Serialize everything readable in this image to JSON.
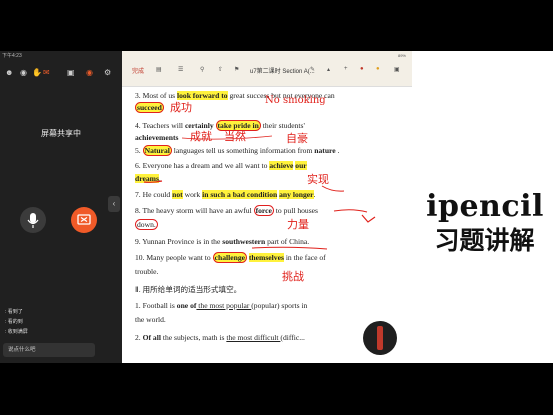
{
  "left_panel": {
    "status_time": "下午4:23",
    "share_title": "屏幕共享中",
    "share_subtitle": "",
    "mic_label": "",
    "stop_label": "",
    "chat": [
      {
        "name": "",
        "text": "看到了"
      },
      {
        "name": "",
        "text": "看的到"
      },
      {
        "name": "",
        "text": "收到满屏"
      }
    ],
    "chat_placeholder": "说点什么吧"
  },
  "toolbar": {
    "done_label": "完成",
    "doc_title": "u7第二课时  Section A(...",
    "status_text": "89%"
  },
  "doc": {
    "l3a_pre": "3.  Most of us ",
    "l3a_hl": "look forward to",
    "l3a_post": " great success but not everyone can",
    "l3b_hl": "succeed",
    "l4a_pre": "4.  Teachers  will  ",
    "l4a_b": "certainly",
    "l4a_sp": "  ",
    "l4a_hl": "take  pride  in",
    "l4a_post": "  their  students'",
    "l4b_b": "achievements",
    "l5_pre": "5.  ",
    "l5_hl": "Natural",
    "l5_mid": " languages tell us something information from ",
    "l5_b": "nature",
    "l5_post": " .",
    "l6a_pre": "6.  Everyone  has  a  dream  and  we  all  want  to  ",
    "l6a_hl1": "achieve",
    "l6a_sp": "  ",
    "l6a_hl2": "our",
    "l6b_hl": "dreams",
    "l6b_post": ".",
    "l7_pre": "7.  He could ",
    "l7_hl1": "not",
    "l7_mid": " work ",
    "l7_hl2": "in such a bad condition",
    "l7_sp": "   ",
    "l7_hl3": "any longer",
    "l7_post": ".",
    "l8a_pre": "8.  The heavy storm will have an awful ",
    "l8a_b": "force",
    "l8a_post": "  to  pull houses",
    "l8b": "down.",
    "l9_pre": "9.  Yunnan Province is in the ",
    "l9_b": "southwestern",
    "l9_post": "   part of China.",
    "l10a_pre": "10.  Many people want to ",
    "l10a_hl1": "challenge",
    "l10a_sp": "  ",
    "l10a_hl2": "themselves",
    "l10a_post": "  in the face of",
    "l10b": "trouble.",
    "section2": "Ⅱ. 用所给单词的适当形式填空。",
    "q1_pre": "1.  Football is ",
    "q1_b": "one of",
    "q1_blank": "   the    most    popular   ",
    "q1_post": " (popular) sports in",
    "q1b": "the world.",
    "q2_pre": "2.  ",
    "q2_b": "Of all",
    "q2_mid": " the subjects, math is ",
    "q2_blank": "  the    most    difficult  ",
    "q2_post": " (diffic..."
  },
  "handnotes": {
    "n1": "成功",
    "n2": "No smoking",
    "n3": "成就",
    "n4": "当然",
    "n5": "自豪",
    "n6": "实现",
    "n7": "力量",
    "n8": "挑战"
  },
  "brand": {
    "line1": "ipencil",
    "line2": "习题讲解"
  },
  "colors": {
    "highlight": "#fff23c",
    "ink_red": "#e0201a",
    "stop_orange": "#f05a28"
  }
}
